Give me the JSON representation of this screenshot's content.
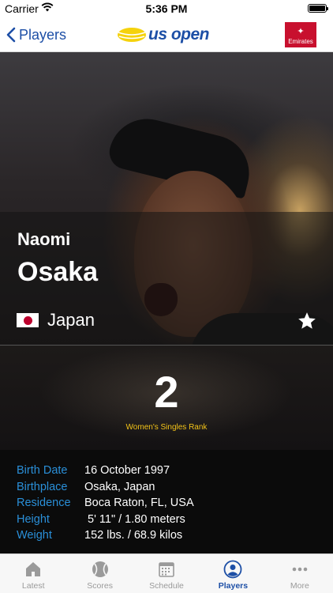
{
  "status_bar": {
    "carrier": "Carrier",
    "time": "5:36 PM"
  },
  "nav": {
    "back_label": "Players",
    "logo_text": "us open",
    "sponsor_text": "Emirates"
  },
  "player": {
    "first_name": "Naomi",
    "last_name": "Osaka",
    "country": "Japan",
    "rank": "2",
    "rank_label": "Women's Singles Rank"
  },
  "bio": [
    {
      "label": "Birth Date",
      "value": "16 October 1997"
    },
    {
      "label": "Birthplace",
      "value": "Osaka, Japan"
    },
    {
      "label": "Residence",
      "value": "Boca Raton, FL, USA"
    },
    {
      "label": "Height",
      "value": " 5' 11\" / 1.80 meters"
    },
    {
      "label": "Weight",
      "value": "152 lbs. / 68.9 kilos"
    }
  ],
  "tabs": [
    {
      "label": "Latest",
      "icon": "home-icon",
      "active": false
    },
    {
      "label": "Scores",
      "icon": "tennis-ball-icon",
      "active": false
    },
    {
      "label": "Schedule",
      "icon": "calendar-icon",
      "active": false
    },
    {
      "label": "Players",
      "icon": "person-icon",
      "active": true
    },
    {
      "label": "More",
      "icon": "more-icon",
      "active": false
    }
  ],
  "colors": {
    "accent_blue": "#1d4fa6",
    "label_blue": "#2a8fd8",
    "rank_yellow": "#f3c319"
  }
}
